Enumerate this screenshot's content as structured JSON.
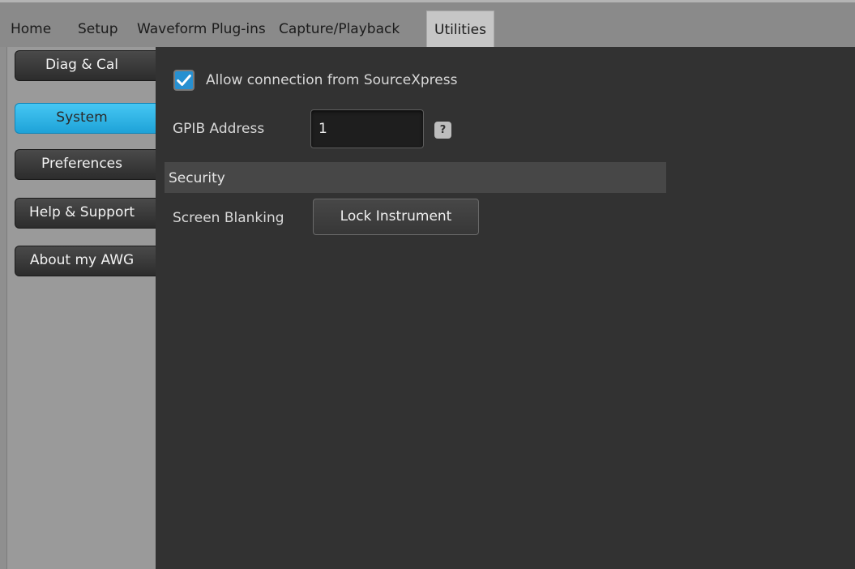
{
  "menu": {
    "items": [
      {
        "label": "Home"
      },
      {
        "label": "Setup"
      },
      {
        "label": "Waveform Plug-ins"
      },
      {
        "label": "Capture/Playback"
      },
      {
        "label": "Utilities",
        "active": true
      }
    ]
  },
  "sidebar": {
    "items": [
      {
        "label": "Diag & Cal"
      },
      {
        "label": "System",
        "active": true
      },
      {
        "label": "Preferences"
      },
      {
        "label": "Help & Support"
      },
      {
        "label": "About my AWG"
      }
    ]
  },
  "system": {
    "allow_connection": {
      "label": "Allow connection from SourceXpress",
      "checked": true
    },
    "gpib": {
      "label": "GPIB Address",
      "value": "1",
      "help": "?"
    },
    "security": {
      "title": "Security",
      "screen_blanking_label": "Screen Blanking",
      "lock_button": "Lock Instrument"
    }
  },
  "colors": {
    "accent": "#1ea2d8",
    "checkbox": "#2790d1",
    "content_bg": "#323232"
  }
}
